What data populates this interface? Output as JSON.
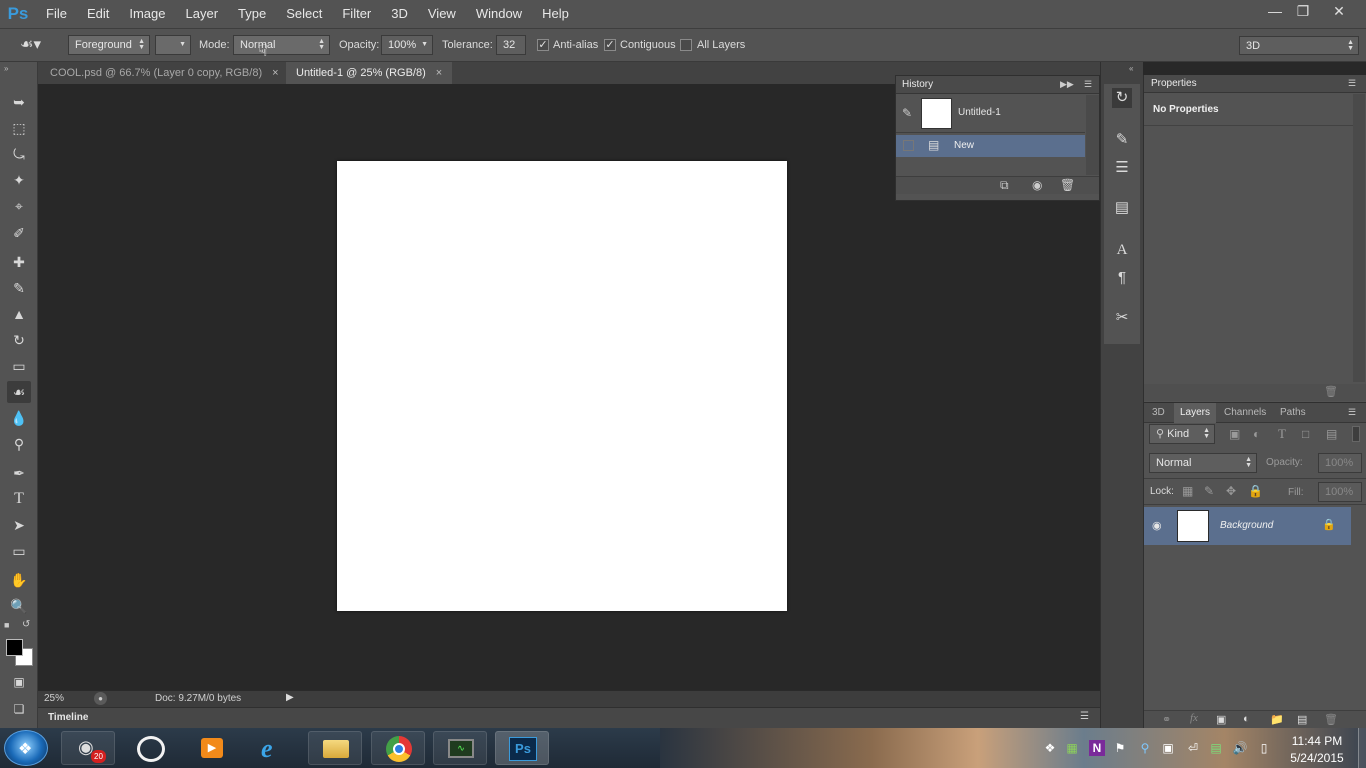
{
  "app": {
    "logo": "Ps"
  },
  "menu": [
    "File",
    "Edit",
    "Image",
    "Layer",
    "Type",
    "Select",
    "Filter",
    "3D",
    "View",
    "Window",
    "Help"
  ],
  "window_controls": {
    "minimize": "—",
    "restore": "❐",
    "close": "✕"
  },
  "options": {
    "fill_source": "Foreground",
    "mode_label": "Mode:",
    "mode_value": "Normal",
    "opacity_label": "Opacity:",
    "opacity_value": "100%",
    "tolerance_label": "Tolerance:",
    "tolerance_value": "32",
    "antialias_label": "Anti-alias",
    "antialias_checked": true,
    "contiguous_label": "Contiguous",
    "contiguous_checked": true,
    "all_layers_label": "All Layers",
    "all_layers_checked": false,
    "workspace": "3D"
  },
  "tabs": [
    {
      "label": "COOL.psd @ 66.7% (Layer 0 copy, RGB/8)",
      "close": "×",
      "active": false
    },
    {
      "label": "Untitled-1 @ 25% (RGB/8)",
      "close": "×",
      "active": true
    }
  ],
  "status": {
    "zoom": "25%",
    "doc": "Doc: 9.27M/0 bytes"
  },
  "timeline": {
    "label": "Timeline"
  },
  "history": {
    "title": "History",
    "snapshot_label": "Untitled-1",
    "states": [
      {
        "label": "New",
        "selected": true
      }
    ]
  },
  "properties": {
    "title": "Properties",
    "content": "No Properties"
  },
  "layers_panel": {
    "tabs": [
      "3D",
      "Layers",
      "Channels",
      "Paths"
    ],
    "active_tab": "Layers",
    "filter_kind": "Kind",
    "blend_mode": "Normal",
    "opacity_label": "Opacity:",
    "opacity_value": "100%",
    "lock_label": "Lock:",
    "fill_label": "Fill:",
    "fill_value": "100%",
    "layers": [
      {
        "name": "Background",
        "locked": true,
        "visible": true
      }
    ]
  },
  "taskbar": {
    "badge": "20",
    "clock_time": "11:44 PM",
    "clock_date": "5/24/2015",
    "ps_label": "Ps"
  }
}
